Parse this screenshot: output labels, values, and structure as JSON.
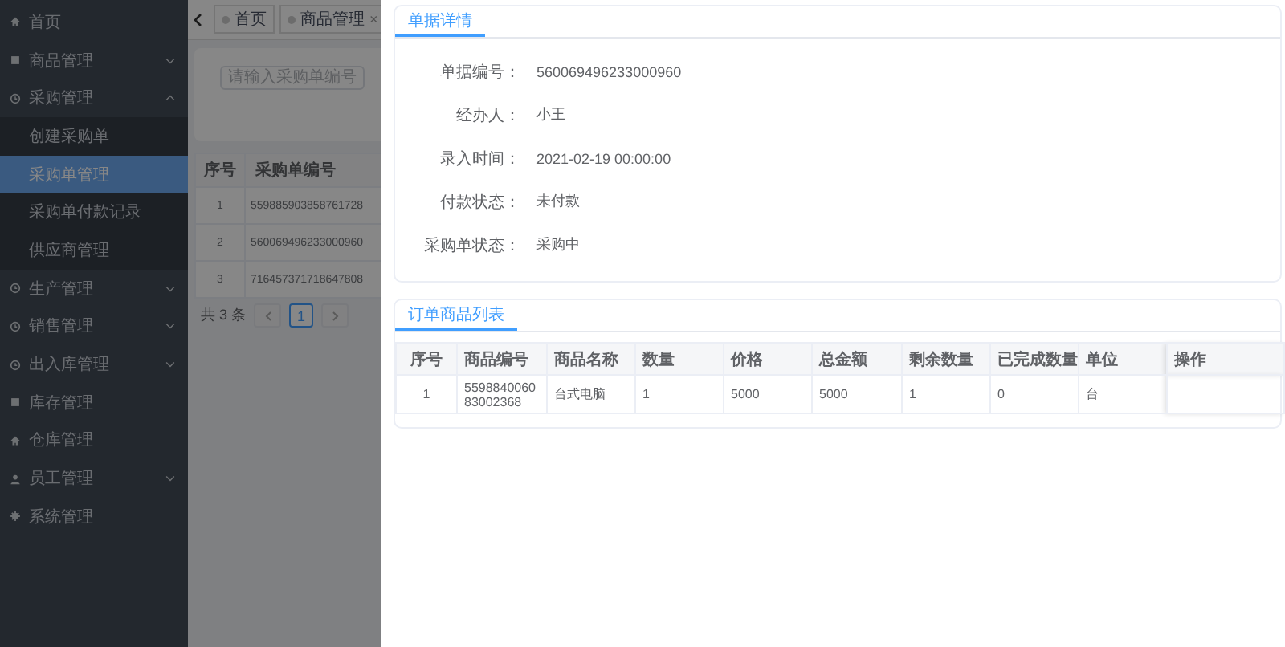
{
  "sidebar": {
    "items": [
      {
        "label": "首页",
        "kind": "link"
      },
      {
        "label": "商品管理",
        "kind": "group",
        "expanded": false
      },
      {
        "label": "采购管理",
        "kind": "group",
        "expanded": true,
        "children": [
          {
            "label": "创建采购单",
            "selected": false
          },
          {
            "label": "采购单管理",
            "selected": true
          },
          {
            "label": "采购单付款记录",
            "selected": false
          },
          {
            "label": "供应商管理",
            "selected": false
          }
        ]
      },
      {
        "label": "生产管理",
        "kind": "group",
        "expanded": false
      },
      {
        "label": "销售管理",
        "kind": "group",
        "expanded": false
      },
      {
        "label": "出入库管理",
        "kind": "group",
        "expanded": false
      },
      {
        "label": "库存管理",
        "kind": "link"
      },
      {
        "label": "仓库管理",
        "kind": "link"
      },
      {
        "label": "员工管理",
        "kind": "group",
        "expanded": false
      },
      {
        "label": "系统管理",
        "kind": "link"
      }
    ]
  },
  "tabs": [
    {
      "label": "首页"
    },
    {
      "label": "商品管理",
      "close": "×"
    }
  ],
  "search": {
    "placeholder": "请输入采购单编号"
  },
  "table": {
    "columns": [
      "序号",
      "采购单编号"
    ],
    "rows": [
      [
        "1",
        "559885903858761728"
      ],
      [
        "2",
        "560069496233000960"
      ],
      [
        "3",
        "716457371718647808"
      ]
    ]
  },
  "pagination": {
    "total": "共 3 条",
    "pages": [
      {
        "label": "1",
        "selected": true
      }
    ]
  },
  "drawer": {
    "detail": {
      "tab": "单据详情",
      "fields": [
        {
          "label": "单据编号：",
          "value": "560069496233000960"
        },
        {
          "label": "经办人：",
          "value": "小王"
        },
        {
          "label": "录入时间：",
          "value": "2021-02-19 00:00:00"
        },
        {
          "label": "付款状态：",
          "value": "未付款"
        },
        {
          "label": "采购单状态：",
          "value": "采购中"
        }
      ]
    },
    "items": {
      "tab": "订单商品列表",
      "columns": [
        "序号",
        "商品编号",
        "商品名称",
        "数量",
        "价格",
        "总金额",
        "剩余数量",
        "已完成数量",
        "单位",
        "操作"
      ],
      "rows": [
        [
          "1",
          "559884006083002368",
          "台式电脑",
          "1",
          "5000",
          "5000",
          "1",
          "0",
          "台",
          ""
        ]
      ]
    }
  }
}
